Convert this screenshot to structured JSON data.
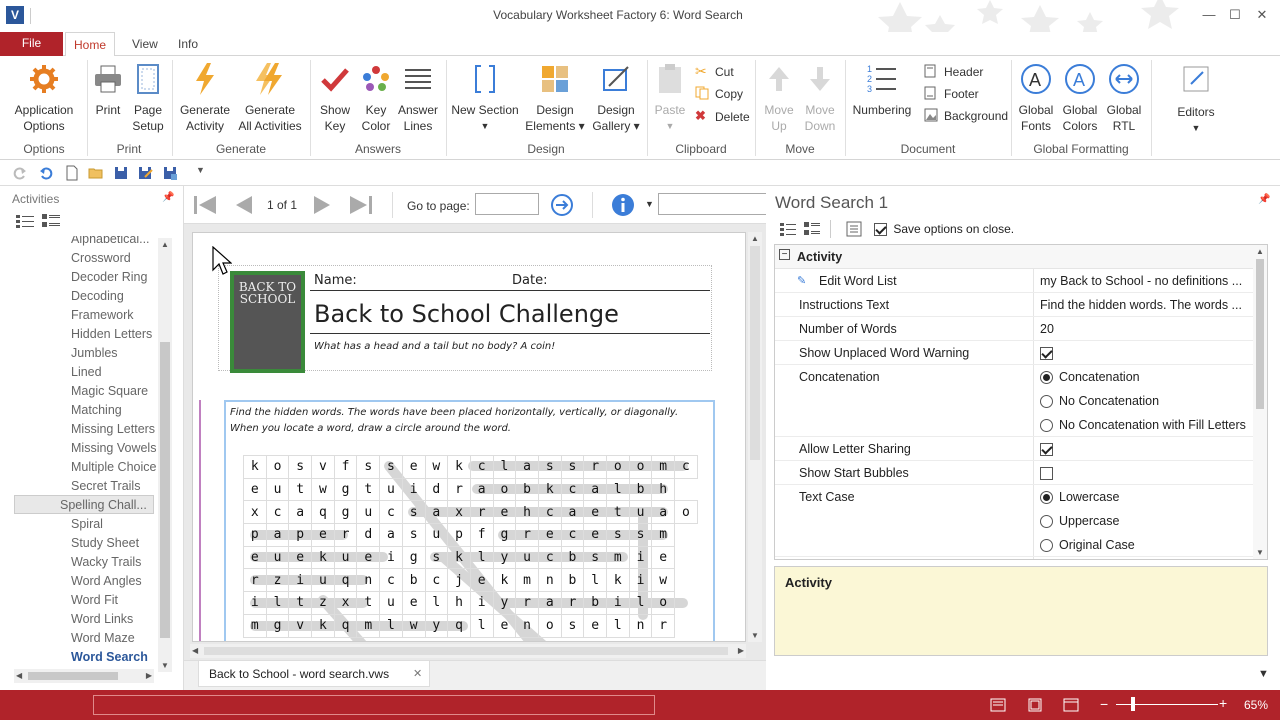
{
  "app": {
    "title": "Vocabulary Worksheet Factory 6: Word Search",
    "icon_letter": "V"
  },
  "ribbon_tabs": [
    "File",
    "Home",
    "View",
    "Info"
  ],
  "ribbon": {
    "options": {
      "app_options": "Application\nOptions",
      "group": "Options"
    },
    "print": {
      "print": "Print",
      "page_setup": "Page\nSetup",
      "group": "Print"
    },
    "generate": {
      "generate_activity": "Generate\nActivity",
      "generate_all": "Generate\nAll Activities",
      "group": "Generate"
    },
    "answers": {
      "show_key": "Show\nKey",
      "key_color": "Key\nColor",
      "answer_lines": "Answer\nLines",
      "group": "Answers"
    },
    "design": {
      "new_section": "New Section",
      "design_elements": "Design\nElements ▾",
      "design_gallery": "Design\nGallery ▾",
      "group": "Design"
    },
    "clipboard": {
      "paste": "Paste",
      "cut": "Cut",
      "copy": "Copy",
      "delete": "Delete",
      "group": "Clipboard"
    },
    "move": {
      "move_up": "Move\nUp",
      "move_down": "Move\nDown",
      "group": "Move"
    },
    "document": {
      "numbering": "Numbering",
      "header": "Header",
      "footer": "Footer",
      "background": "Background",
      "group": "Document"
    },
    "global_formatting": {
      "fonts": "Global\nFonts",
      "colors": "Global\nColors",
      "rtl": "Global\nRTL",
      "group": "Global Formatting"
    },
    "editors": {
      "label": "Editors"
    }
  },
  "activities_panel": {
    "title": "Activities",
    "items": [
      "Alphabetical...",
      "Crossword",
      "Decoder Ring",
      "Decoding",
      "Framework",
      "Hidden Letters",
      "Jumbles",
      "Lined",
      "Magic Square",
      "Matching",
      "Missing Letters",
      "Missing Vowels",
      "Multiple Choice",
      "Secret Trails",
      "Spelling Chall...",
      "Spiral",
      "Study Sheet",
      "Wacky Trails",
      "Word Angles",
      "Word Fit",
      "Word Links",
      "Word Maze",
      "Word Search"
    ],
    "selected": "Spelling Chall...",
    "active": "Word Search"
  },
  "navbar": {
    "page_indicator": "1 of 1",
    "goto_label": "Go to page:",
    "goto_value": ""
  },
  "worksheet": {
    "logo_text": "BACK TO SCHOOL",
    "name_label": "Name:",
    "date_label": "Date:",
    "title": "Back to School Challenge",
    "subtitle": "What has a head and a tail but no body? A coin!",
    "instructions": "Find the hidden words. The words have been placed horizontally, vertically, or diagonally. When you locate a word, draw a circle around the word.",
    "grid": [
      "kosvfssewkclassroomc",
      "eutwgtuidraobkcalbh",
      "xcaqgucsaxrehcaetuao",
      "paperdasupfgrecessm",
      "euekueigsklyucbsmie",
      "rziuqncbcjekmnblkiw",
      "iltzxtuelhiyrarbilo",
      "mgvkqmlwyqlenoselnr"
    ]
  },
  "doc_tab": {
    "label": "Back to School - word search.vws",
    "close": "✕"
  },
  "props_panel": {
    "title": "Word Search 1",
    "save_options": "Save options on close.",
    "save_options_checked": true,
    "section": "Activity",
    "rows": [
      {
        "name": "Edit Word List",
        "value": "my Back to School - no definitions ..."
      },
      {
        "name": "Instructions Text",
        "value": "Find the hidden words. The words ..."
      },
      {
        "name": "Number of Words",
        "value": "20"
      },
      {
        "name": "Show Unplaced Word Warning",
        "value": "checked"
      },
      {
        "name": "Concatenation",
        "value": "Concatenation"
      },
      {
        "name": "Allow Letter Sharing",
        "value": "checked"
      },
      {
        "name": "Show Start Bubbles",
        "value": "unchecked"
      },
      {
        "name": "Text Case",
        "value": "Lowercase"
      }
    ],
    "concatenation_options": [
      "Concatenation",
      "No Concatenation",
      "No Concatenation with Fill Letters"
    ],
    "text_case_options": [
      "Lowercase",
      "Uppercase",
      "Original Case"
    ],
    "description_title": "Activity"
  },
  "status": {
    "zoom": "65%"
  },
  "colors": {
    "accent": "#b0232a",
    "ribbon_active_tab": "#c0392b",
    "info_box": "#fbf7d6"
  }
}
